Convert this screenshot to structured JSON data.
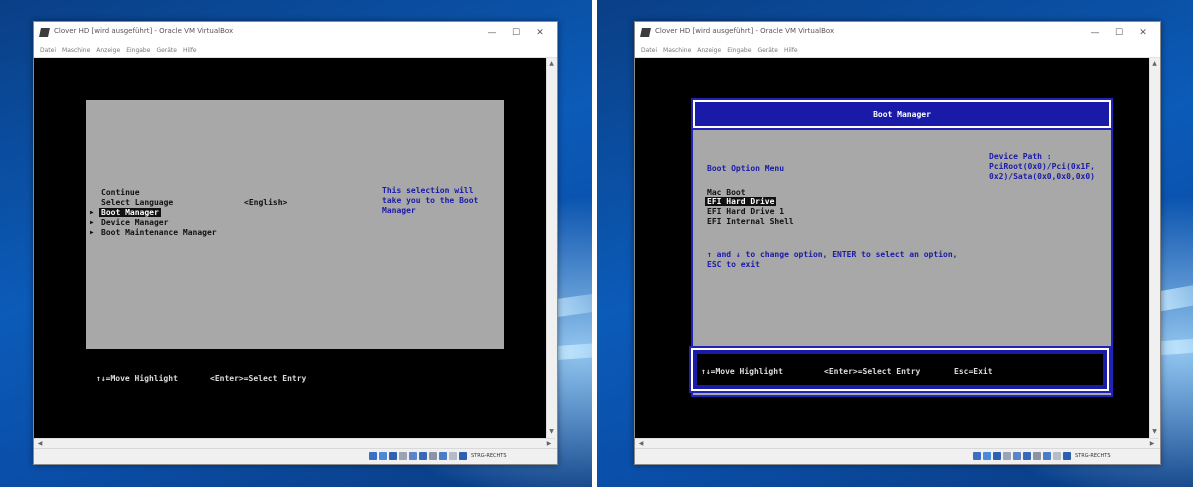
{
  "left": {
    "window": {
      "title": "Clover HD [wird ausgeführt] - Oracle VM VirtualBox",
      "controls": [
        "—",
        "☐",
        "✕"
      ],
      "menu": [
        "Datei",
        "Maschine",
        "Anzeige",
        "Eingabe",
        "Geräte",
        "Hilfe"
      ],
      "host_key": "STRG-RECHTS"
    },
    "bios": {
      "menu_items": [
        {
          "arrow": "",
          "label": "Continue",
          "selected": false
        },
        {
          "arrow": "",
          "label": "Select Language",
          "selected": false
        },
        {
          "arrow": "▶",
          "label": "Boot Manager",
          "selected": true
        },
        {
          "arrow": "▶",
          "label": "Device Manager",
          "selected": false
        },
        {
          "arrow": "▶",
          "label": "Boot Maintenance Manager",
          "selected": false
        }
      ],
      "language_value": "<English>",
      "help_text": [
        "This selection will",
        "take you to the Boot",
        "Manager"
      ],
      "hints": [
        "↑↓=Move Highlight",
        "<Enter>=Select Entry"
      ]
    }
  },
  "right": {
    "window": {
      "title": "Clover HD [wird ausgeführt] - Oracle VM VirtualBox",
      "controls": [
        "—",
        "☐",
        "✕"
      ],
      "menu": [
        "Datei",
        "Maschine",
        "Anzeige",
        "Eingabe",
        "Geräte",
        "Hilfe"
      ],
      "host_key": "STRG-RECHTS"
    },
    "boot_manager": {
      "header": "Boot Manager",
      "section_title": "Boot Option Menu",
      "device_path_label": "Device Path :",
      "device_path_lines": [
        "PciRoot(0x0)/Pci(0x1F,",
        "0x2)/Sata(0x0,0x0,0x0)"
      ],
      "options": [
        {
          "label": "Mac Boot",
          "selected": false
        },
        {
          "label": "EFI Hard Drive",
          "selected": true
        },
        {
          "label": "EFI Hard Drive 1",
          "selected": false
        },
        {
          "label": "EFI Internal Shell",
          "selected": false
        }
      ],
      "instructions": [
        "↑ and ↓ to change option, ENTER to select an option,",
        "ESC to exit"
      ],
      "hints": [
        "↑↓=Move Highlight",
        "<Enter>=Select Entry",
        "Esc=Exit"
      ]
    }
  },
  "colors": {
    "bios_gray": "#a8a8a8",
    "bios_blue": "#1a1aa8",
    "desktop_blue": "#0b5bb8"
  },
  "status_icons": [
    "hdd-icon",
    "optical-icon",
    "usb-icon",
    "shared-folder-icon",
    "display-icon",
    "network-icon",
    "recording-icon",
    "cpu-icon",
    "mouse-icon",
    "host-key-icon"
  ]
}
